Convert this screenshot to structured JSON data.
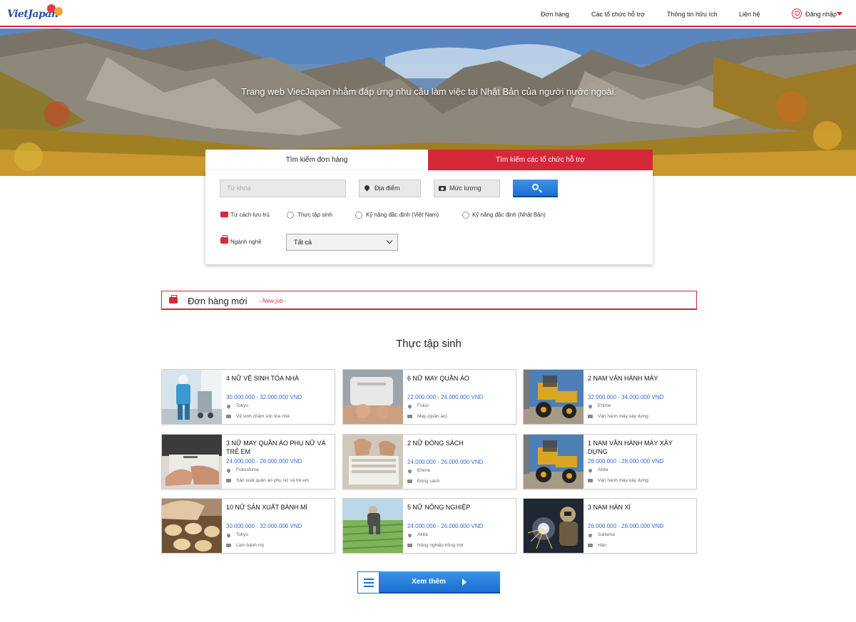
{
  "header": {
    "logo_text": "VietJapan",
    "nav": [
      {
        "label": "Đơn hàng"
      },
      {
        "label": "Các tổ chức hỗ trợ"
      },
      {
        "label": "Thông tin hữu ích"
      },
      {
        "label": "Liên hệ"
      }
    ],
    "login_label": "Đăng nhập",
    "accent_color": "#d7283a"
  },
  "hero": {
    "text": "Trang web ViecJapan nhằm đáp ứng nhu cầu làm việc tại Nhật Bản của người nước ngoài."
  },
  "search": {
    "tabs": [
      {
        "label": "Tìm kiếm đơn hàng",
        "active": true
      },
      {
        "label": "Tìm kiếm các tổ chức hỗ trợ",
        "active": false
      }
    ],
    "keyword_placeholder": "Từ khóa",
    "location_label": "Địa điểm",
    "salary_label": "Mức lương",
    "status_label": "Tư cách lưu trú",
    "status_options": [
      "Thực tập sinh",
      "Kỹ năng đặc định (Việt Nam)",
      "Kỹ năng đặc định (Nhật Bản)"
    ],
    "industry_label": "Ngành nghề",
    "industry_value": "Tất cả"
  },
  "new_jobs": {
    "title": "Đơn hàng mới",
    "subtitle": "- New job -"
  },
  "section_title": "Thực tập sinh",
  "jobs": [
    {
      "title": "4 NỮ VỆ SINH TÒA NHÀ",
      "salary": "30.000.000 - 32.000.000 VND",
      "location": "Tokyo",
      "industry": "Vệ sinh chăm sóc tòa nhà",
      "thumb": "cleaning"
    },
    {
      "title": "6 NỮ MAY QUẦN ÁO",
      "salary": "22.000.000 - 24.000.000 VND",
      "location": "Fukui",
      "industry": "May (quần áo)",
      "thumb": "sewing"
    },
    {
      "title": "2 NAM VẬN HÀNH MÁY",
      "salary": "32.000.000 - 34.000.000 VND",
      "location": "Ehime",
      "industry": "Vận hành máy xây dựng",
      "thumb": "loader"
    },
    {
      "title": "3 NỮ MAY QUẦN ÁO PHỤ NỮ VÀ TRẺ EM",
      "salary": "24.000.000 - 26.000.000 VND",
      "location": "Fukushima",
      "industry": "Sản xuất quần áo phụ nữ và trẻ em",
      "thumb": "sewing2"
    },
    {
      "title": "2 NỮ ĐÓNG SÁCH",
      "salary": "24.000.000 - 26.000.000 VND",
      "location": "Ehime",
      "industry": "Đóng sách",
      "thumb": "books"
    },
    {
      "title": "1 NAM VẬN HÀNH MÁY XÂY DỰNG",
      "salary": "26.000.000 - 28.000.000 VND",
      "location": "Akita",
      "industry": "Vận hành máy xây dựng",
      "thumb": "loader"
    },
    {
      "title": "10 NỮ SẢN XUẤT BÁNH MÌ",
      "salary": "30.000.000 - 32.000.000 VND",
      "location": "Tokyo",
      "industry": "Làm bánh mỳ",
      "thumb": "bread"
    },
    {
      "title": "5 NỮ NÔNG NGHIỆP",
      "salary": "24.000.000 - 26.000.000 VND",
      "location": "Akita",
      "industry": "Nông nghiệp trồng trọt",
      "thumb": "farm"
    },
    {
      "title": "3 NAM HÀN XÌ",
      "salary": "26.000.000 - 28.000.000 VND",
      "location": "Saitama",
      "industry": "Hàn",
      "thumb": "welding"
    }
  ],
  "more_button_label": "Xem thêm"
}
